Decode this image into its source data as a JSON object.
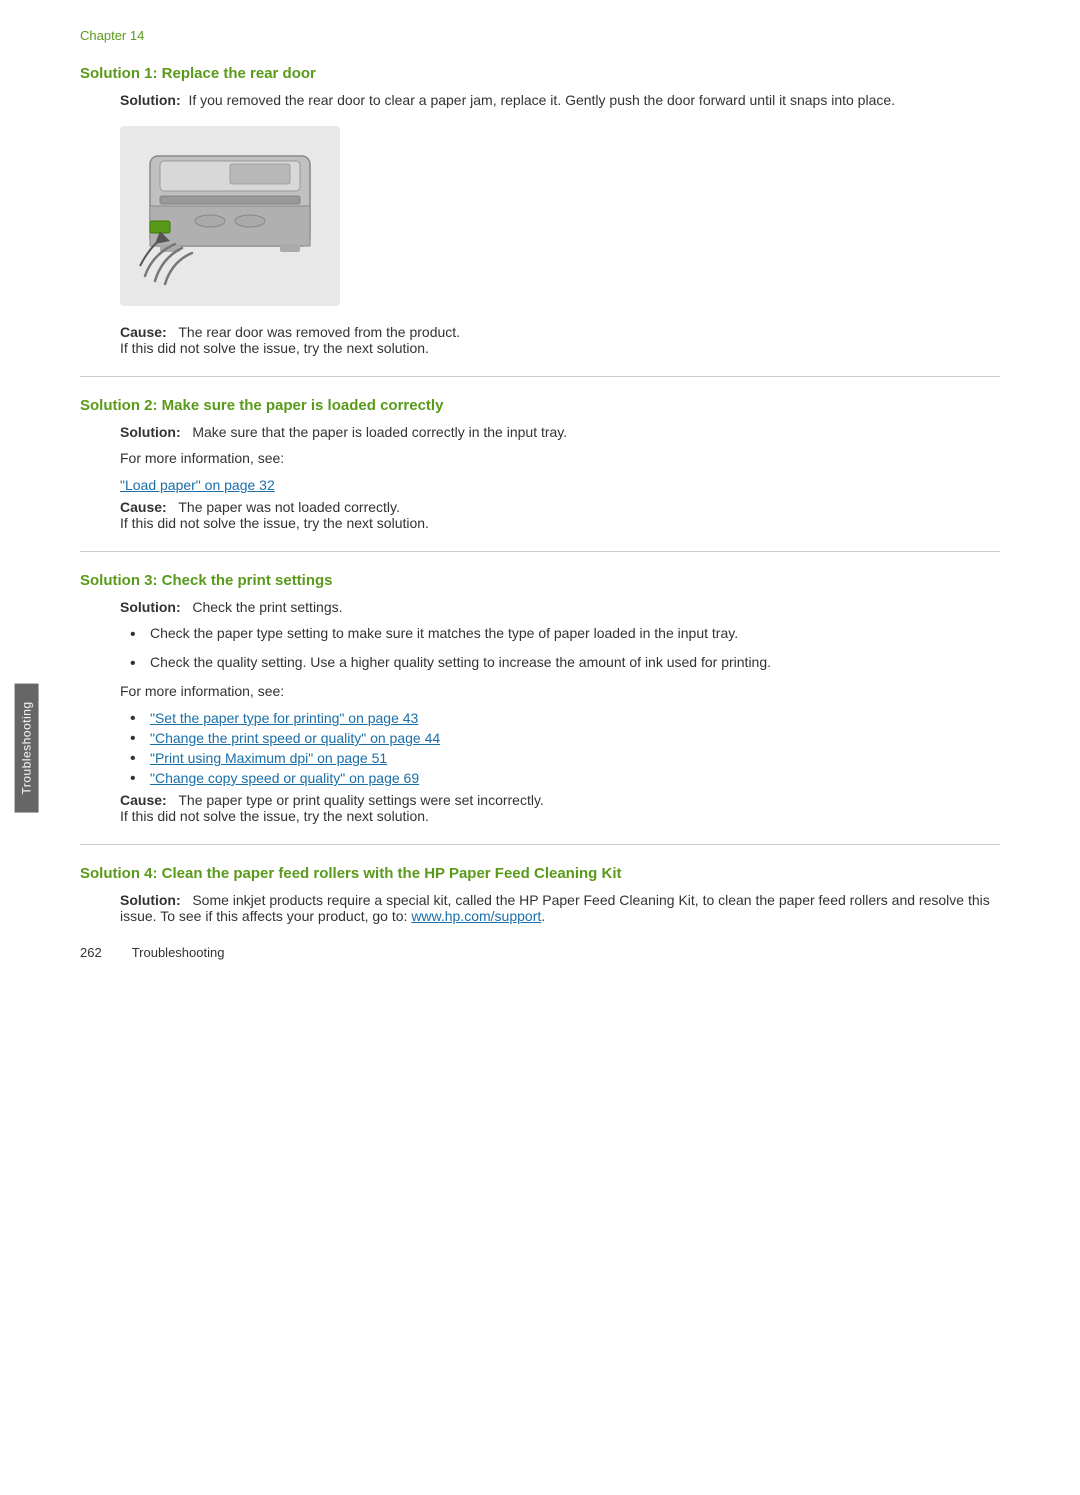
{
  "page": {
    "chapter_label": "Chapter 14",
    "sidebar_tab": "Troubleshooting",
    "footer": {
      "page_number": "262",
      "section": "Troubleshooting"
    }
  },
  "solutions": [
    {
      "id": "solution1",
      "heading": "Solution 1: Replace the rear door",
      "solution_label": "Solution:",
      "solution_text": "If you removed the rear door to clear a paper jam, replace it. Gently push the door forward until it snaps into place.",
      "cause_label": "Cause:",
      "cause_text": "The rear door was removed from the product.",
      "next_solution_text": "If this did not solve the issue, try the next solution.",
      "has_image": true,
      "image_alt": "Printer rear door illustration"
    },
    {
      "id": "solution2",
      "heading": "Solution 2: Make sure the paper is loaded correctly",
      "solution_label": "Solution:",
      "solution_text": "Make sure that the paper is loaded correctly in the input tray.",
      "for_more_info": "For more information, see:",
      "link": "\"Load paper\" on page 32",
      "cause_label": "Cause:",
      "cause_text": "The paper was not loaded correctly.",
      "next_solution_text": "If this did not solve the issue, try the next solution."
    },
    {
      "id": "solution3",
      "heading": "Solution 3: Check the print settings",
      "solution_label": "Solution:",
      "solution_text": "Check the print settings.",
      "bullets": [
        "Check the paper type setting to make sure it matches the type of paper loaded in the input tray.",
        "Check the quality setting. Use a higher quality setting to increase the amount of ink used for printing."
      ],
      "for_more_info": "For more information, see:",
      "links": [
        "\"Set the paper type for printing\" on page 43",
        "\"Change the print speed or quality\" on page 44",
        "\"Print using Maximum dpi\" on page 51",
        "\"Change copy speed or quality\" on page 69"
      ],
      "cause_label": "Cause:",
      "cause_text": "The paper type or print quality settings were set incorrectly.",
      "next_solution_text": "If this did not solve the issue, try the next solution."
    },
    {
      "id": "solution4",
      "heading": "Solution 4: Clean the paper feed rollers with the HP Paper Feed Cleaning Kit",
      "solution_label": "Solution:",
      "solution_text": "Some inkjet products require a special kit, called the HP Paper Feed Cleaning Kit, to clean the paper feed rollers and resolve this issue. To see if this affects your product, go to:",
      "link": "www.hp.com/support",
      "link_suffix": "."
    }
  ]
}
